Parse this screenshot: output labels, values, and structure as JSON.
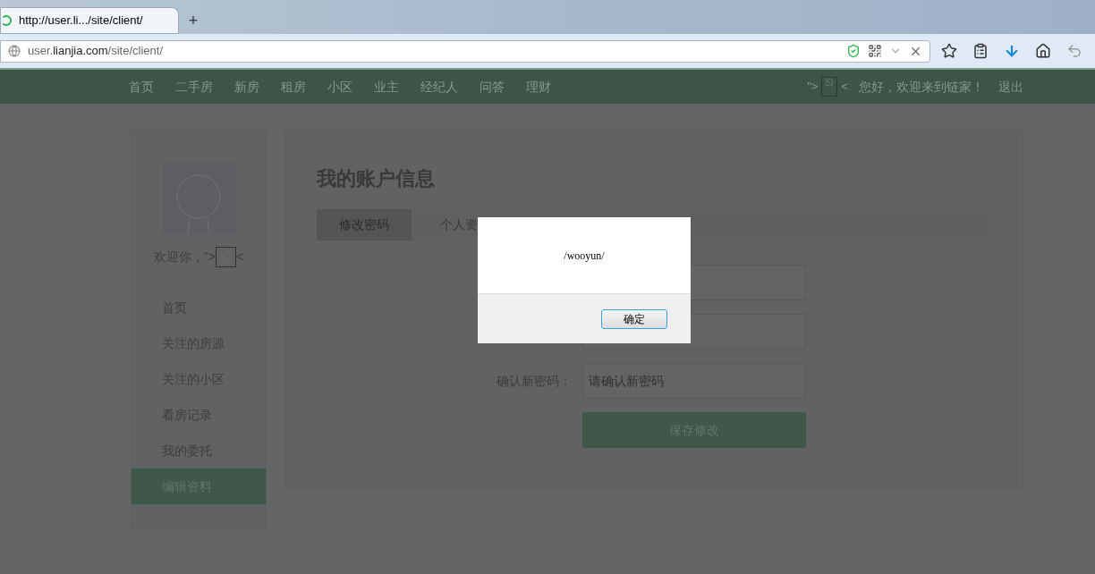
{
  "browser": {
    "tab_title": "http://user.li.../site/client/",
    "new_tab": "+",
    "url": {
      "prefix": "user.",
      "host": "lianjia.com",
      "path": "/site/client/"
    }
  },
  "nav": {
    "items": [
      "首页",
      "二手房",
      "新房",
      "租房",
      "小区",
      "业主",
      "经纪人",
      "问答",
      "理财"
    ],
    "broken_markup_before": "\">",
    "broken_markup_after": "<",
    "greeting": "您好，欢迎来到链家！",
    "logout": "退出"
  },
  "sidebar": {
    "welcome": "欢迎你，\">",
    "welcome_after": "<",
    "items": [
      {
        "label": "首页",
        "selected": false
      },
      {
        "label": "关注的房源",
        "selected": false
      },
      {
        "label": "关注的小区",
        "selected": false
      },
      {
        "label": "看房记录",
        "selected": false
      },
      {
        "label": "我的委托",
        "selected": false
      },
      {
        "label": "编辑资料",
        "selected": true
      }
    ]
  },
  "main": {
    "title": "我的账户信息",
    "tabs": [
      {
        "label": "修改密码",
        "selected": true
      },
      {
        "label": "个人资",
        "selected": false
      }
    ],
    "fields": [
      {
        "kind": "password"
      },
      {
        "kind": "password"
      },
      {
        "kind": "password",
        "label": "确认新密码：",
        "placeholder": "请确认新密码"
      }
    ],
    "save_button": "保存修改"
  },
  "dialog": {
    "message": "/wooyun/",
    "button": "确定"
  }
}
